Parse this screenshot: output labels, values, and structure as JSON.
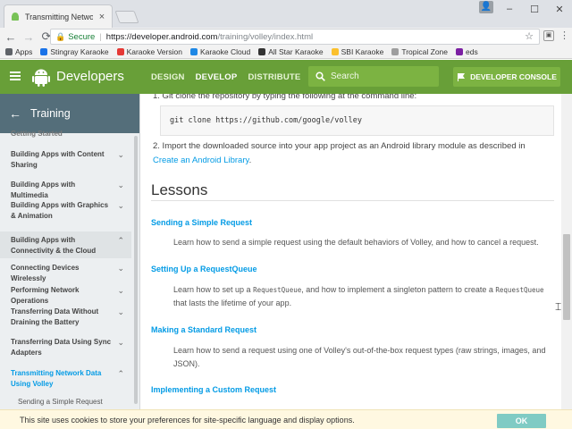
{
  "browser": {
    "tab_title": "Transmitting Network Da",
    "tab_close": "×",
    "window_controls": [
      "–",
      "☐",
      "✕"
    ],
    "nav": {
      "back": "←",
      "forward": "→",
      "reload": "⟳"
    },
    "secure_label": "Secure",
    "url_main": "https://developer.android.com",
    "url_path": "/training/volley/index.html",
    "bookmarks": [
      {
        "label": "Apps",
        "icon": "apps-grid-icon",
        "color": "#5f6368"
      },
      {
        "label": "Stingray Karaoke",
        "icon": "stingray-icon",
        "color": "#1a73e8"
      },
      {
        "label": "Karaoke Version",
        "icon": "mic-icon",
        "color": "#e53935"
      },
      {
        "label": "Karaoke Cloud",
        "icon": "cloud-icon",
        "color": "#1e88e5"
      },
      {
        "label": "All Star Karaoke",
        "icon": "star-circle-icon",
        "color": "#333333"
      },
      {
        "label": "SBI Karaoke",
        "icon": "music-note-icon",
        "color": "#fbc02d"
      },
      {
        "label": "Tropical Zone",
        "icon": "page-icon",
        "color": "#9e9e9e"
      },
      {
        "label": "eds",
        "icon": "eds-icon",
        "color": "#7b1fa2"
      }
    ]
  },
  "header": {
    "brand": "Developers",
    "nav": [
      "DESIGN",
      "DEVELOP",
      "DISTRIBUTE"
    ],
    "active_nav": "DEVELOP",
    "search_placeholder": "Search",
    "console_label": "DEVELOPER CONSOLE",
    "colors": {
      "bar": "#689f38",
      "accent": "#7cb342"
    }
  },
  "sidebar": {
    "title": "Training",
    "items": [
      {
        "label": "Getting Started",
        "chevron": "",
        "state": ""
      },
      {
        "label": "Building Apps with Content Sharing",
        "chevron": "⌄",
        "state": ""
      },
      {
        "label": "Building Apps with Multimedia",
        "chevron": "⌄",
        "state": ""
      },
      {
        "label": "Building Apps with Graphics & Animation",
        "chevron": "⌄",
        "state": ""
      },
      {
        "label": "Building Apps with Connectivity & the Cloud",
        "chevron": "⌃",
        "state": "hl"
      },
      {
        "label": "Connecting Devices Wirelessly",
        "chevron": "⌄",
        "state": ""
      },
      {
        "label": "Performing Network Operations",
        "chevron": "⌄",
        "state": ""
      },
      {
        "label": "Transferring Data Without Draining the Battery",
        "chevron": "⌄",
        "state": ""
      },
      {
        "label": "Transferring Data Using Sync Adapters",
        "chevron": "⌄",
        "state": ""
      },
      {
        "label": "Transmitting Network Data Using Volley",
        "chevron": "⌃",
        "state": "active"
      }
    ],
    "sub_item": "Sending a Simple Request"
  },
  "content": {
    "step1": "1. Git clone the repository by typing the following at the command line:",
    "code": "git clone https://github.com/google/volley",
    "step2_prefix": "2. Import the downloaded source into your app project as an Android library module as described in ",
    "step2_link": "Create an Android Library",
    "step2_suffix": ".",
    "lessons_title": "Lessons",
    "lessons": [
      {
        "title": "Sending a Simple Request",
        "desc": "Learn how to send a simple request using the default behaviors of Volley, and how to cancel a request."
      },
      {
        "title": "Setting Up a RequestQueue",
        "desc_a": "Learn how to set up a ",
        "code_a": "RequestQueue",
        "desc_b": ", and how to implement a singleton pattern to create a ",
        "code_b": "RequestQueue",
        "desc_c": " that lasts the lifetime of your app."
      },
      {
        "title": "Making a Standard Request",
        "desc": "Learn how to send a request using one of Volley's out-of-the-box request types (raw strings, images, and JSON)."
      },
      {
        "title": "Implementing a Custom Request",
        "desc": ""
      }
    ]
  },
  "cookie": {
    "text": "This site uses cookies to store your preferences for site-specific language and display options.",
    "ok_label": "OK"
  }
}
